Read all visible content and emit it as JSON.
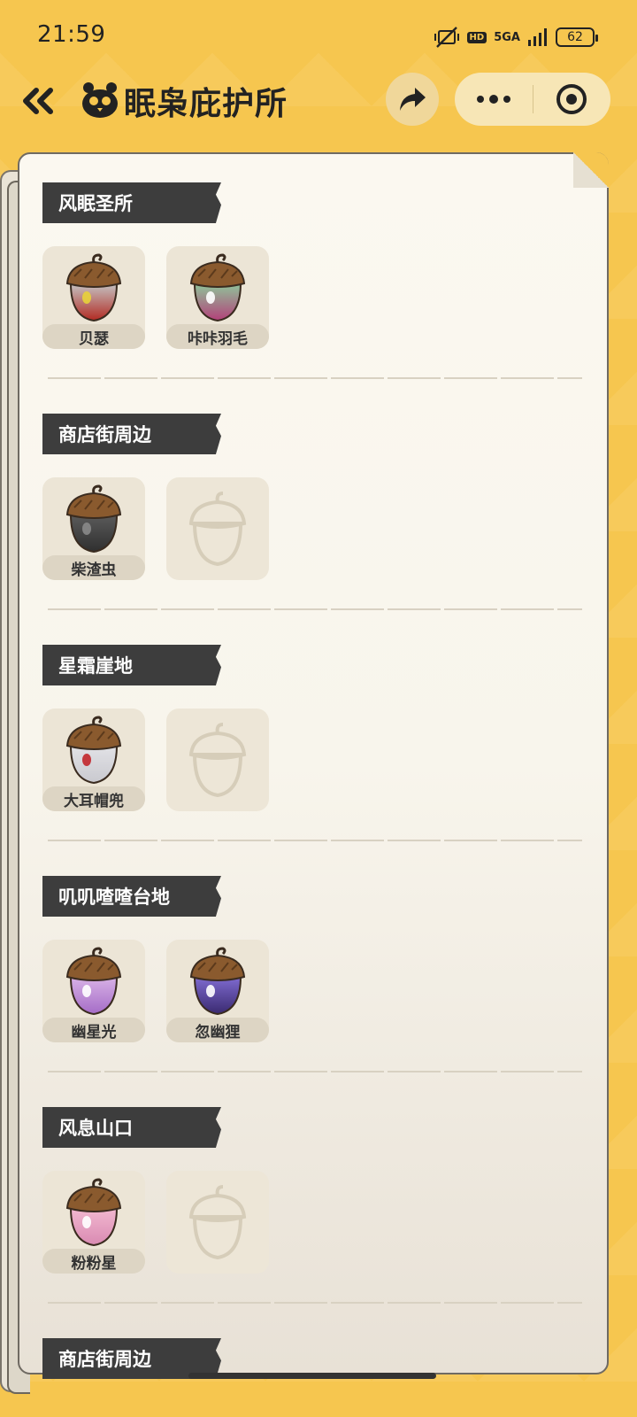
{
  "status_bar": {
    "time": "21:59",
    "hd": "HD",
    "network": "5GA",
    "battery": "62"
  },
  "header": {
    "title": "眠枭庇护所"
  },
  "sections": [
    {
      "title": "风眠圣所",
      "items": [
        {
          "label": "贝瑟",
          "colors": [
            "#c4c4c4",
            "#b22a22"
          ],
          "accent": "#e8d23a",
          "empty": false
        },
        {
          "label": "咔咔羽毛",
          "colors": [
            "#8fc59a",
            "#b3407a"
          ],
          "accent": "#ffffff",
          "empty": false
        }
      ]
    },
    {
      "title": "商店街周边",
      "items": [
        {
          "label": "柴渣虫",
          "colors": [
            "#5b5b5b",
            "#2f2f2f"
          ],
          "accent": "#8a8a8a",
          "empty": false
        },
        {
          "label": "",
          "empty": true
        }
      ]
    },
    {
      "title": "星霜崖地",
      "items": [
        {
          "label": "大耳帽兜",
          "colors": [
            "#e2e2e6",
            "#c9c9cf"
          ],
          "accent": "#c2262b",
          "empty": false
        },
        {
          "label": "",
          "empty": true
        }
      ]
    },
    {
      "title": "叽叽喳喳台地",
      "items": [
        {
          "label": "幽星光",
          "colors": [
            "#d8b2e6",
            "#a56cc7"
          ],
          "accent": "#ffffff",
          "empty": false
        },
        {
          "label": "忽幽狸",
          "colors": [
            "#7f6bd0",
            "#3a2a70"
          ],
          "accent": "#ffffff",
          "empty": false
        }
      ]
    },
    {
      "title": "风息山口",
      "items": [
        {
          "label": "粉粉星",
          "colors": [
            "#f2b8d0",
            "#d98ab2"
          ],
          "accent": "#ffffff",
          "empty": false
        },
        {
          "label": "",
          "empty": true
        }
      ]
    },
    {
      "title": "商店街周边",
      "items": []
    }
  ]
}
